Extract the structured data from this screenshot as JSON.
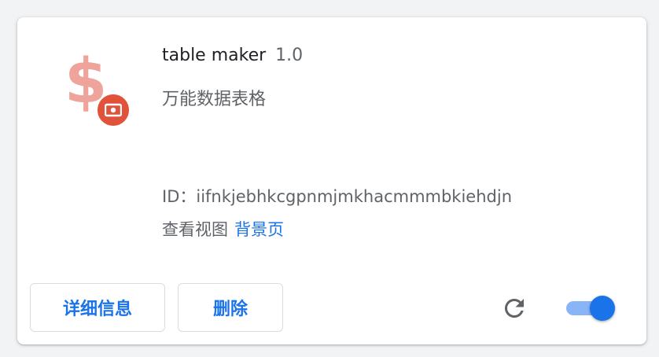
{
  "extension": {
    "name": "table maker",
    "version": "1.0",
    "description": "万能数据表格",
    "id_label": "ID：",
    "id_value": "iifnkjebhkcgpnmjmkhacmmmbkiehdjn",
    "views_label": "查看视图",
    "views_link": "背景页",
    "icon_glyph": "$",
    "icon_name": "dollar-money-icon",
    "enabled": true
  },
  "buttons": {
    "details_label": "详细信息",
    "remove_label": "删除"
  },
  "colors": {
    "accent": "#1a73e8",
    "toggle_track": "#8ab4f8",
    "icon_dollar": "#eea49a",
    "icon_badge": "#e0533a"
  }
}
